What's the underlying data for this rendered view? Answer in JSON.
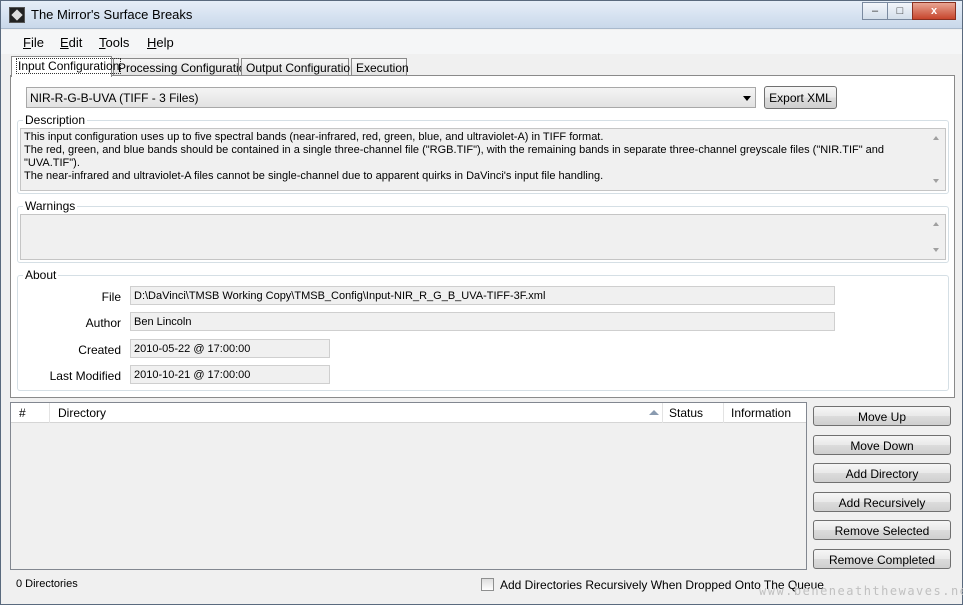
{
  "window": {
    "title": "The Mirror's Surface Breaks",
    "buttons": {
      "minimize": "–",
      "maximize": "□",
      "close": "x"
    }
  },
  "menu": [
    {
      "hotkey": "F",
      "rest": "ile"
    },
    {
      "hotkey": "E",
      "rest": "dit"
    },
    {
      "hotkey": "T",
      "rest": "ools"
    },
    {
      "hotkey": "H",
      "rest": "elp"
    }
  ],
  "tabs": [
    "Input Configuration",
    "Processing Configuration",
    "Output Configuration",
    "Execution"
  ],
  "input_config": {
    "selected_config": "NIR-R-G-B-UVA (TIFF - 3 Files)",
    "export_button": "Export XML",
    "description": {
      "title": "Description",
      "text": "This input configuration uses up to five spectral bands (near-infrared, red, green, blue, and ultraviolet-A) in TIFF format.\nThe red, green, and blue bands should be contained in a single three-channel file (\"RGB.TIF\"), with the remaining bands in separate three-channel greyscale files (\"NIR.TIF\" and \"UVA.TIF\").\nThe near-infrared and ultraviolet-A files cannot be single-channel due to apparent quirks in DaVinci's input file handling."
    },
    "warnings": {
      "title": "Warnings",
      "text": ""
    },
    "about": {
      "title": "About",
      "file_label": "File",
      "file": "D:\\DaVinci\\TMSB Working Copy\\TMSB_Config\\Input-NIR_R_G_B_UVA-TIFF-3F.xml",
      "author_label": "Author",
      "author": "Ben Lincoln",
      "created_label": "Created",
      "created": "2010-05-22 @ 17:00:00",
      "modified_label": "Last Modified",
      "modified": "2010-10-21 @ 17:00:00"
    }
  },
  "queue": {
    "columns": [
      "#",
      "Directory",
      "Status",
      "Information"
    ],
    "rows": [],
    "buttons": [
      "Move Up",
      "Move Down",
      "Add Directory",
      "Add Recursively",
      "Remove Selected",
      "Remove Completed"
    ],
    "count_text": "0 Directories",
    "recursive_checkbox_label": "Add Directories Recursively When Dropped Onto The Queue",
    "recursive_checked": false
  },
  "watermark": "www.beneneaththewaves.net"
}
